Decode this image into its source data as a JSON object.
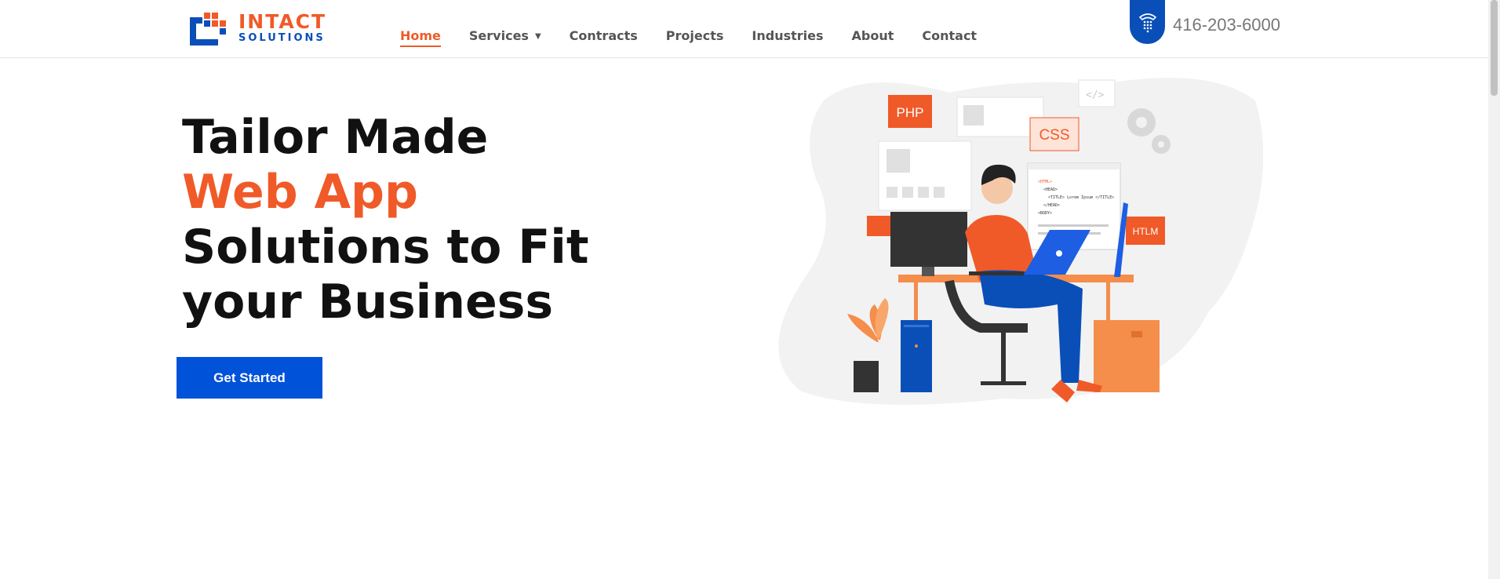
{
  "brand": {
    "name_line1": "INTACT",
    "name_line2": "SOLUTIONS",
    "colors": {
      "orange": "#f05a28",
      "blue": "#0a4fb8",
      "cta": "#0052d9"
    }
  },
  "nav": {
    "items": [
      {
        "label": "Home",
        "active": true
      },
      {
        "label": "Services",
        "has_dropdown": true
      },
      {
        "label": "Contracts"
      },
      {
        "label": "Projects"
      },
      {
        "label": "Industries"
      },
      {
        "label": "About"
      },
      {
        "label": "Contact"
      }
    ]
  },
  "contact": {
    "phone": "416-203-6000",
    "icon": "phone-icon"
  },
  "hero": {
    "line1": "Tailor Made",
    "line2": "Web App",
    "line3": "Solutions to Fit",
    "line4": "your Business",
    "cta_label": "Get Started"
  },
  "illustration": {
    "tags": [
      "PHP",
      "CSS",
      "HTLM"
    ],
    "code_lines": [
      "<HTML>",
      "<HEAD>",
      "<TITLE> Lorem Ipsum </TITLE>",
      "</HEAD>",
      "<BODY>"
    ]
  }
}
